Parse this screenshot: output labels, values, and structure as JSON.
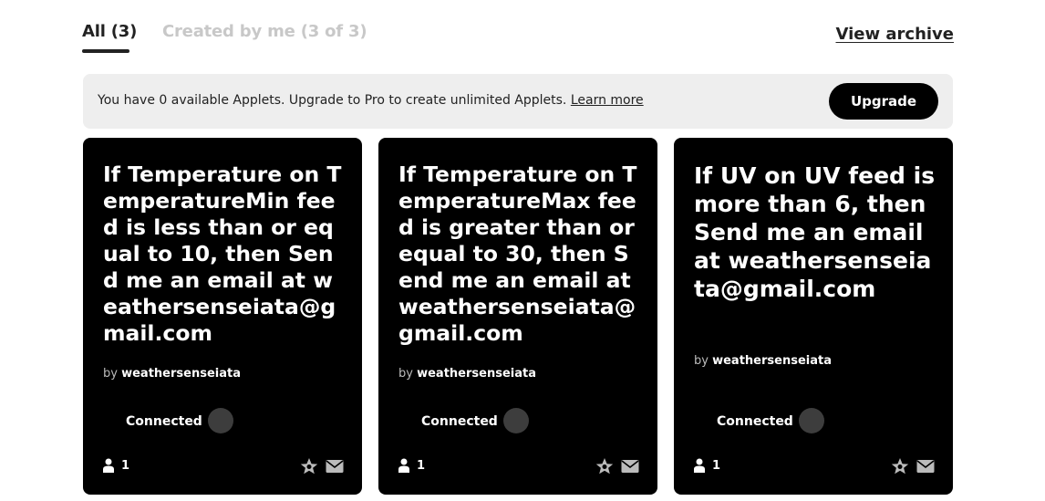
{
  "tabs": {
    "all_label": "All (3)",
    "mine_label": "Created by me (3 of 3)"
  },
  "view_archive_label": "View archive",
  "banner": {
    "text": "You have 0 available Applets. Upgrade to Pro to create unlimited Applets.",
    "learn_more_label": "Learn more",
    "upgrade_label": "Upgrade"
  },
  "applets": [
    {
      "title": "If Temperature on TemperatureMin feed is less than or equal to 10, then Send me an email at weathersenseiata@gmail.com",
      "by_prefix": "by",
      "author": "weathersenseiata",
      "status": "Connected",
      "user_count": "1",
      "service_icons": [
        "adafruit-star-icon",
        "email-icon"
      ]
    },
    {
      "title": "If Temperature on TemperatureMax feed is greater than or equal to 30, then Send me an email at weathersenseiata@gmail.com",
      "by_prefix": "by",
      "author": "weathersenseiata",
      "status": "Connected",
      "user_count": "1",
      "service_icons": [
        "adafruit-star-icon",
        "email-icon"
      ]
    },
    {
      "title": "If UV on UV feed is more than 6, then Send me an email at weathersenseiata@gmail.com",
      "by_prefix": "by",
      "author": "weathersenseiata",
      "status": "Connected",
      "user_count": "1",
      "service_icons": [
        "adafruit-star-icon",
        "email-icon"
      ]
    }
  ],
  "colors": {
    "card_bg": "#000000",
    "banner_bg": "#eeeeee",
    "inactive_tab": "#c8c8c8",
    "toggle_knob": "#3d3d3d"
  }
}
